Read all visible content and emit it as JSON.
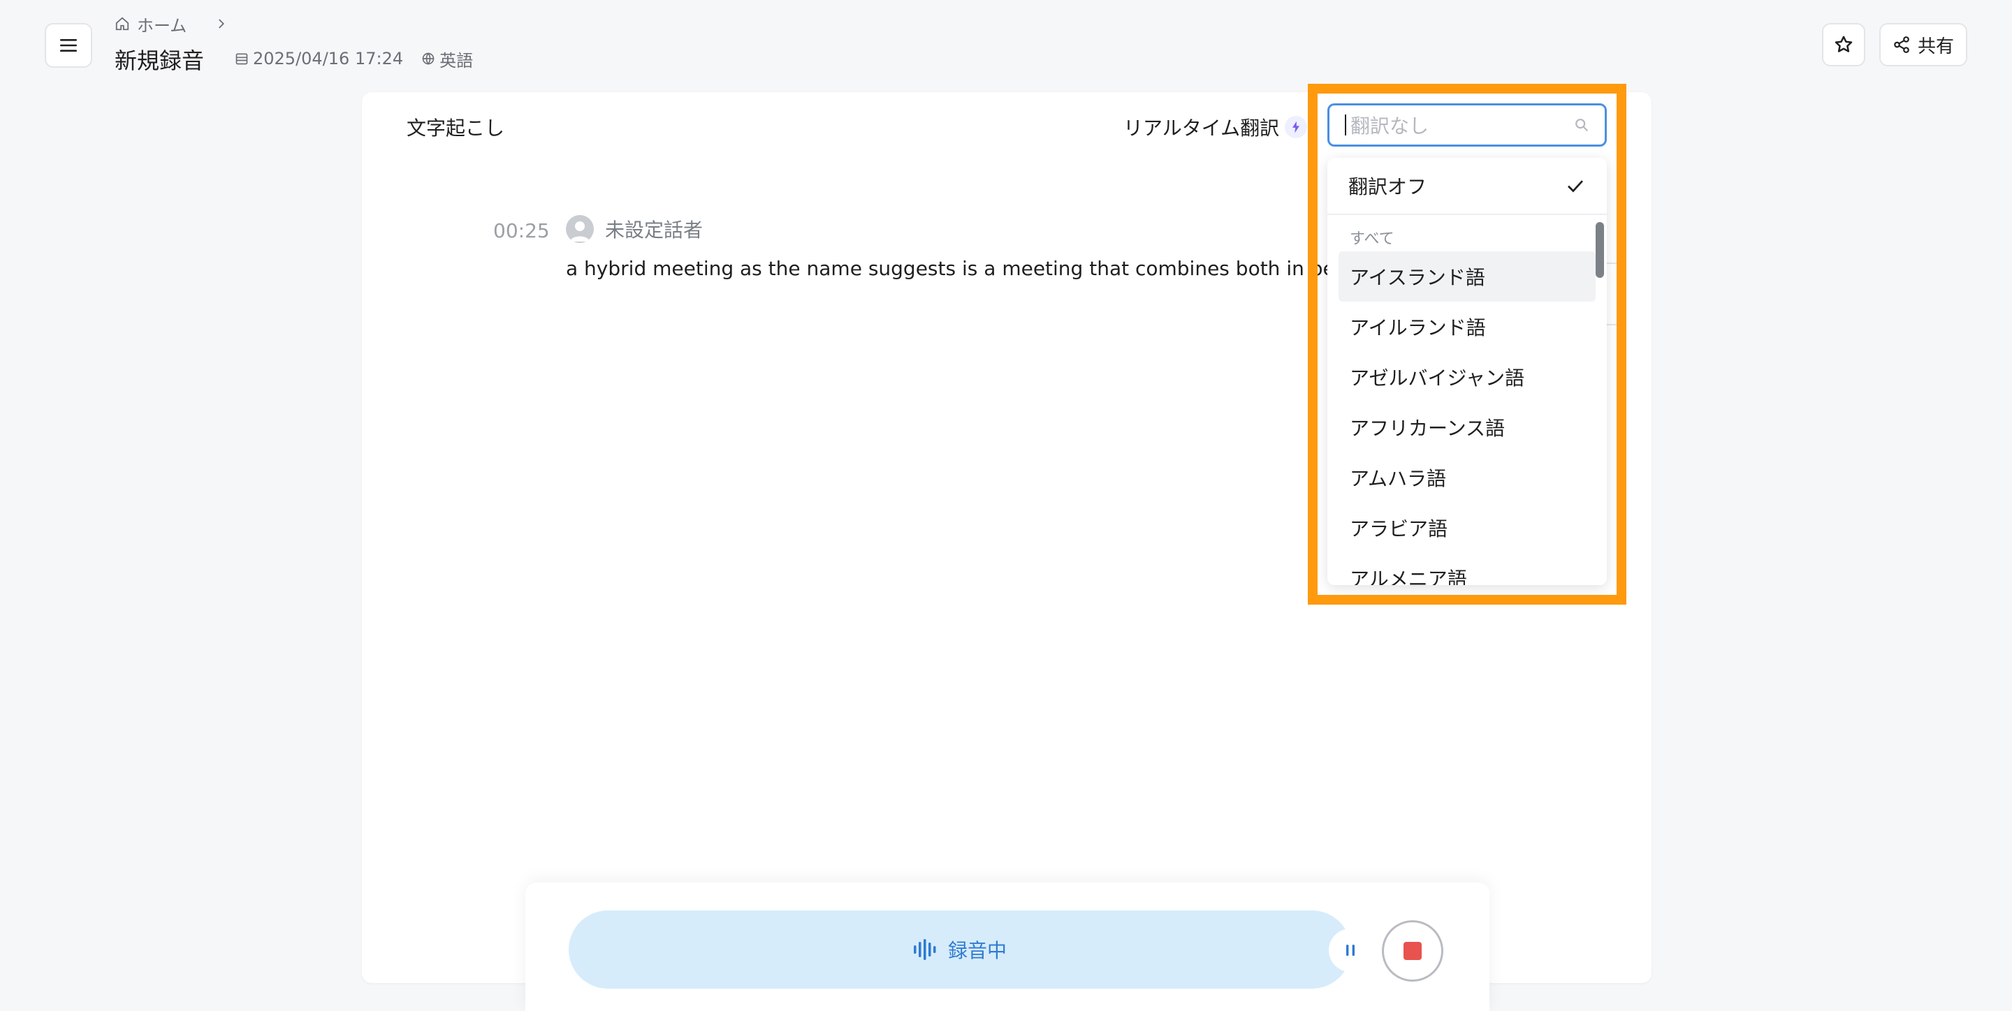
{
  "header": {
    "menu_icon": "hamburger-icon",
    "breadcrumb": {
      "home_icon": "home-icon",
      "home_label": "ホーム",
      "separator_icon": "chevron-right-icon"
    },
    "title": "新規録音",
    "date": "2025/04/16 17:24",
    "date_icon": "calendar-icon",
    "language": "英語",
    "language_icon": "globe-icon",
    "star_icon": "star-icon",
    "share_icon": "share-icon",
    "share_label": "共有"
  },
  "card": {
    "tab_title": "文字起こし",
    "realtime_label": "リアルタイム翻訳",
    "realtime_icon": "sparkle-icon"
  },
  "transcript": [
    {
      "time": "00:25",
      "speaker": "未設定話者",
      "text": "a hybrid meeting as the name suggests is a meeting that combines both in person"
    }
  ],
  "translation_select": {
    "placeholder": "翻訳なし",
    "search_icon": "search-icon",
    "off_label": "翻訳オフ",
    "off_selected": true,
    "group_label": "すべて",
    "options": [
      "アイスランド語",
      "アイルランド語",
      "アゼルバイジャン語",
      "アフリカーンス語",
      "アムハラ語",
      "アラビア語",
      "アルメニア語"
    ]
  },
  "recording": {
    "status_label": "録音中",
    "wave_icon": "waveform-icon",
    "pause_icon": "pause-icon",
    "stop_icon": "stop-icon"
  },
  "colors": {
    "highlight": "#ff9a0e",
    "accent": "#4a90e2",
    "recording_bg": "#d6ecfb",
    "stop_red": "#e8524f"
  }
}
